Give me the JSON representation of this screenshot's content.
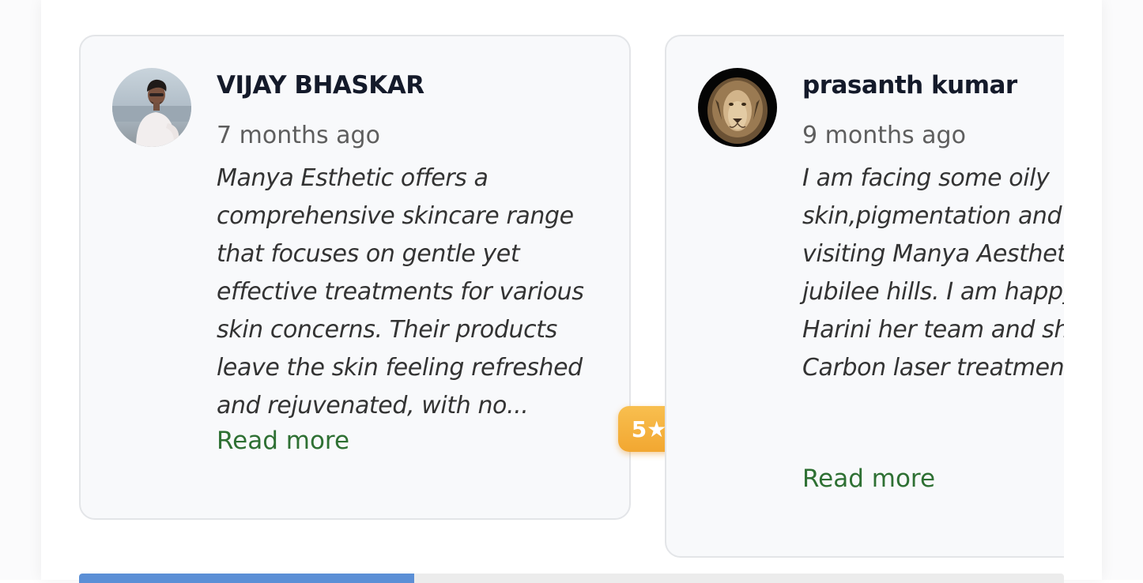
{
  "reviews": [
    {
      "author": "VIJAY BHASKAR",
      "time": "7 months ago",
      "text": "Manya Esthetic offers a comprehensive skincare range that focuses on gentle yet effective treatments for various skin concerns. Their products leave the skin feeling refreshed and rejuvenated, with no...",
      "read_more": "Read more",
      "avatar_icon": "person-photo-avatar"
    },
    {
      "author": "prasanth kumar",
      "time": "9 months ago",
      "text": "I am facing some oily skin,pigmentation and after visiting Manya Aesthetic clinic jubilee hills. I am happy with Dr. Harini her team and she suggest Carbon laser treatment s...",
      "read_more": "Read more",
      "avatar_icon": "lion-avatar"
    }
  ],
  "badges": {
    "left": "5★",
    "mid": "5★"
  },
  "carousel": {
    "progress_fraction": 0.34
  },
  "colors": {
    "badge": "#f4b03a",
    "read_more": "#2e7033",
    "progress": "#5b8fd6"
  }
}
